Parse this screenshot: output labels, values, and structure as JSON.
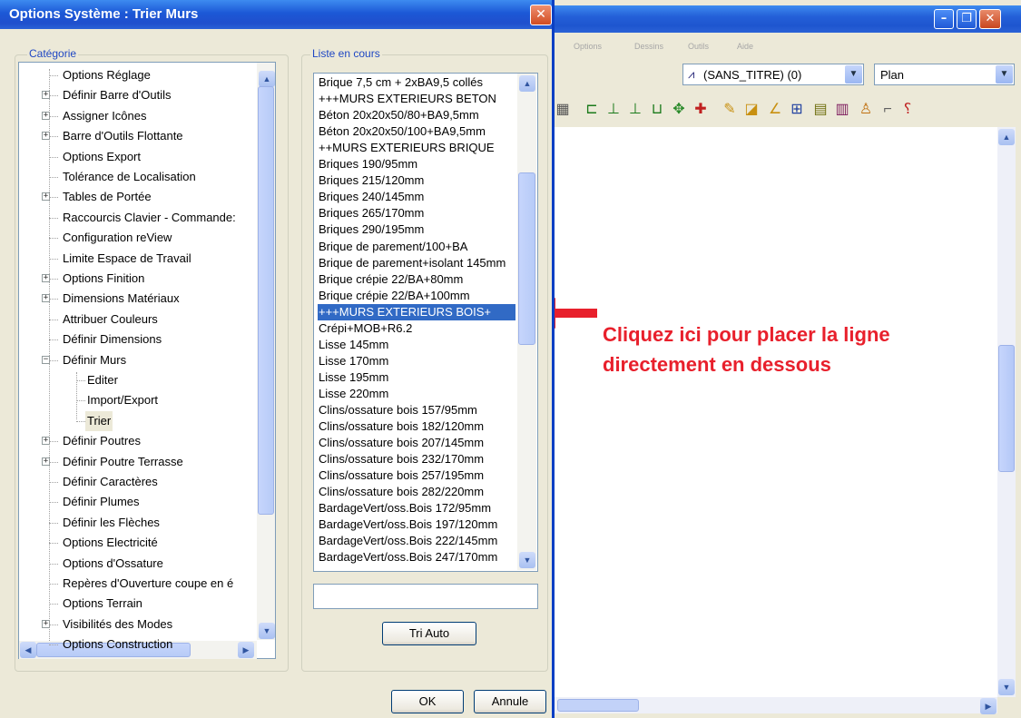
{
  "dialog": {
    "title": "Options Système : Trier Murs",
    "category_label": "Catégorie",
    "list_label": "Liste en cours",
    "tri_auto_label": "Tri Auto",
    "ok_label": "OK",
    "cancel_label": "Annule",
    "list_input_value": ""
  },
  "tree": [
    {
      "label": "Options Réglage",
      "expander": false,
      "level": 0
    },
    {
      "label": "Définir Barre d'Outils",
      "expander": true,
      "level": 0
    },
    {
      "label": "Assigner Icônes",
      "expander": true,
      "level": 0
    },
    {
      "label": "Barre d'Outils Flottante",
      "expander": true,
      "level": 0
    },
    {
      "label": "Options Export",
      "expander": false,
      "level": 0
    },
    {
      "label": "Tolérance de Localisation",
      "expander": false,
      "level": 0
    },
    {
      "label": "Tables de Portée",
      "expander": true,
      "level": 0
    },
    {
      "label": "Raccourcis Clavier - Commande:",
      "expander": false,
      "level": 0
    },
    {
      "label": "Configuration reView",
      "expander": false,
      "level": 0
    },
    {
      "label": "Limite Espace de Travail",
      "expander": false,
      "level": 0
    },
    {
      "label": "Options Finition",
      "expander": true,
      "level": 0
    },
    {
      "label": "Dimensions Matériaux",
      "expander": true,
      "level": 0
    },
    {
      "label": "Attribuer Couleurs",
      "expander": false,
      "level": 0
    },
    {
      "label": "Définir Dimensions",
      "expander": false,
      "level": 0
    },
    {
      "label": "Définir Murs",
      "expander": "open",
      "level": 0
    },
    {
      "label": "Editer",
      "expander": false,
      "level": 1
    },
    {
      "label": "Import/Export",
      "expander": false,
      "level": 1
    },
    {
      "label": "Trier",
      "expander": false,
      "level": 1,
      "selected": true
    },
    {
      "label": "Définir Poutres",
      "expander": true,
      "level": 0
    },
    {
      "label": "Définir Poutre Terrasse",
      "expander": true,
      "level": 0
    },
    {
      "label": "Définir Caractères",
      "expander": false,
      "level": 0
    },
    {
      "label": "Définir Plumes",
      "expander": false,
      "level": 0
    },
    {
      "label": "Définir les Flèches",
      "expander": false,
      "level": 0
    },
    {
      "label": "Options Electricité",
      "expander": false,
      "level": 0
    },
    {
      "label": "Options d'Ossature",
      "expander": false,
      "level": 0
    },
    {
      "label": "Repères d'Ouverture coupe en é",
      "expander": false,
      "level": 0
    },
    {
      "label": "Options Terrain",
      "expander": false,
      "level": 0
    },
    {
      "label": "Visibilités des Modes",
      "expander": true,
      "level": 0
    },
    {
      "label": "Options Construction",
      "expander": false,
      "level": 0
    }
  ],
  "wall_list": [
    {
      "label": "Brique 7,5 cm + 2xBA9,5 collés"
    },
    {
      "label": "+++MURS EXTERIEURS BETON"
    },
    {
      "label": "Béton 20x20x50/80+BA9,5mm"
    },
    {
      "label": "Béton 20x20x50/100+BA9,5mm"
    },
    {
      "label": "++MURS EXTERIEURS BRIQUE"
    },
    {
      "label": "Briques 190/95mm"
    },
    {
      "label": "Briques 215/120mm"
    },
    {
      "label": "Briques 240/145mm"
    },
    {
      "label": "Briques 265/170mm"
    },
    {
      "label": "Briques 290/195mm"
    },
    {
      "label": "Brique de parement/100+BA"
    },
    {
      "label": "Brique de parement+isolant 145mm"
    },
    {
      "label": "Brique crépie 22/BA+80mm"
    },
    {
      "label": "Brique crépie 22/BA+100mm"
    },
    {
      "label": "+++MURS EXTERIEURS BOIS+",
      "selected": true
    },
    {
      "label": "Crépi+MOB+R6.2"
    },
    {
      "label": "Lisse 145mm"
    },
    {
      "label": "Lisse 170mm"
    },
    {
      "label": "Lisse 195mm"
    },
    {
      "label": "Lisse 220mm"
    },
    {
      "label": "Clins/ossature bois 157/95mm"
    },
    {
      "label": "Clins/ossature bois 182/120mm"
    },
    {
      "label": "Clins/ossature bois 207/145mm"
    },
    {
      "label": "Clins/ossature bois 232/170mm"
    },
    {
      "label": "Clins/ossature bois 257/195mm"
    },
    {
      "label": "Clins/ossature bois 282/220mm"
    },
    {
      "label": "BardageVert/oss.Bois 172/95mm"
    },
    {
      "label": "BardageVert/oss.Bois 197/120mm"
    },
    {
      "label": "BardageVert/oss.Bois 222/145mm"
    },
    {
      "label": "BardageVert/oss.Bois 247/170mm"
    }
  ],
  "background_window": {
    "menu_items": [
      "Options",
      "Dessins",
      "Outils",
      "Aide"
    ],
    "layer_combo_value": "(SANS_TITRE) (0)",
    "view_combo_value": "Plan",
    "toolbar_icons": [
      "ruler-icon",
      "dim-icon-1",
      "dim-icon-2",
      "dim-icon-3",
      "dim-icon-4",
      "move-icon",
      "add-icon",
      "pencil-icon",
      "edit-frame-icon",
      "angle-icon",
      "grid-icon",
      "hatch-icon",
      "calendar-icon",
      "person-icon",
      "stairs-icon",
      "tool-icon"
    ]
  },
  "annotation": {
    "text": "Cliquez ici pour placer la ligne directement en dessous",
    "color": "#e8202c"
  },
  "colors": {
    "title_bar": "#1c58d6",
    "selection": "#316ac5",
    "dialog_bg": "#ece9d8",
    "legend_text": "#1f47c3"
  }
}
